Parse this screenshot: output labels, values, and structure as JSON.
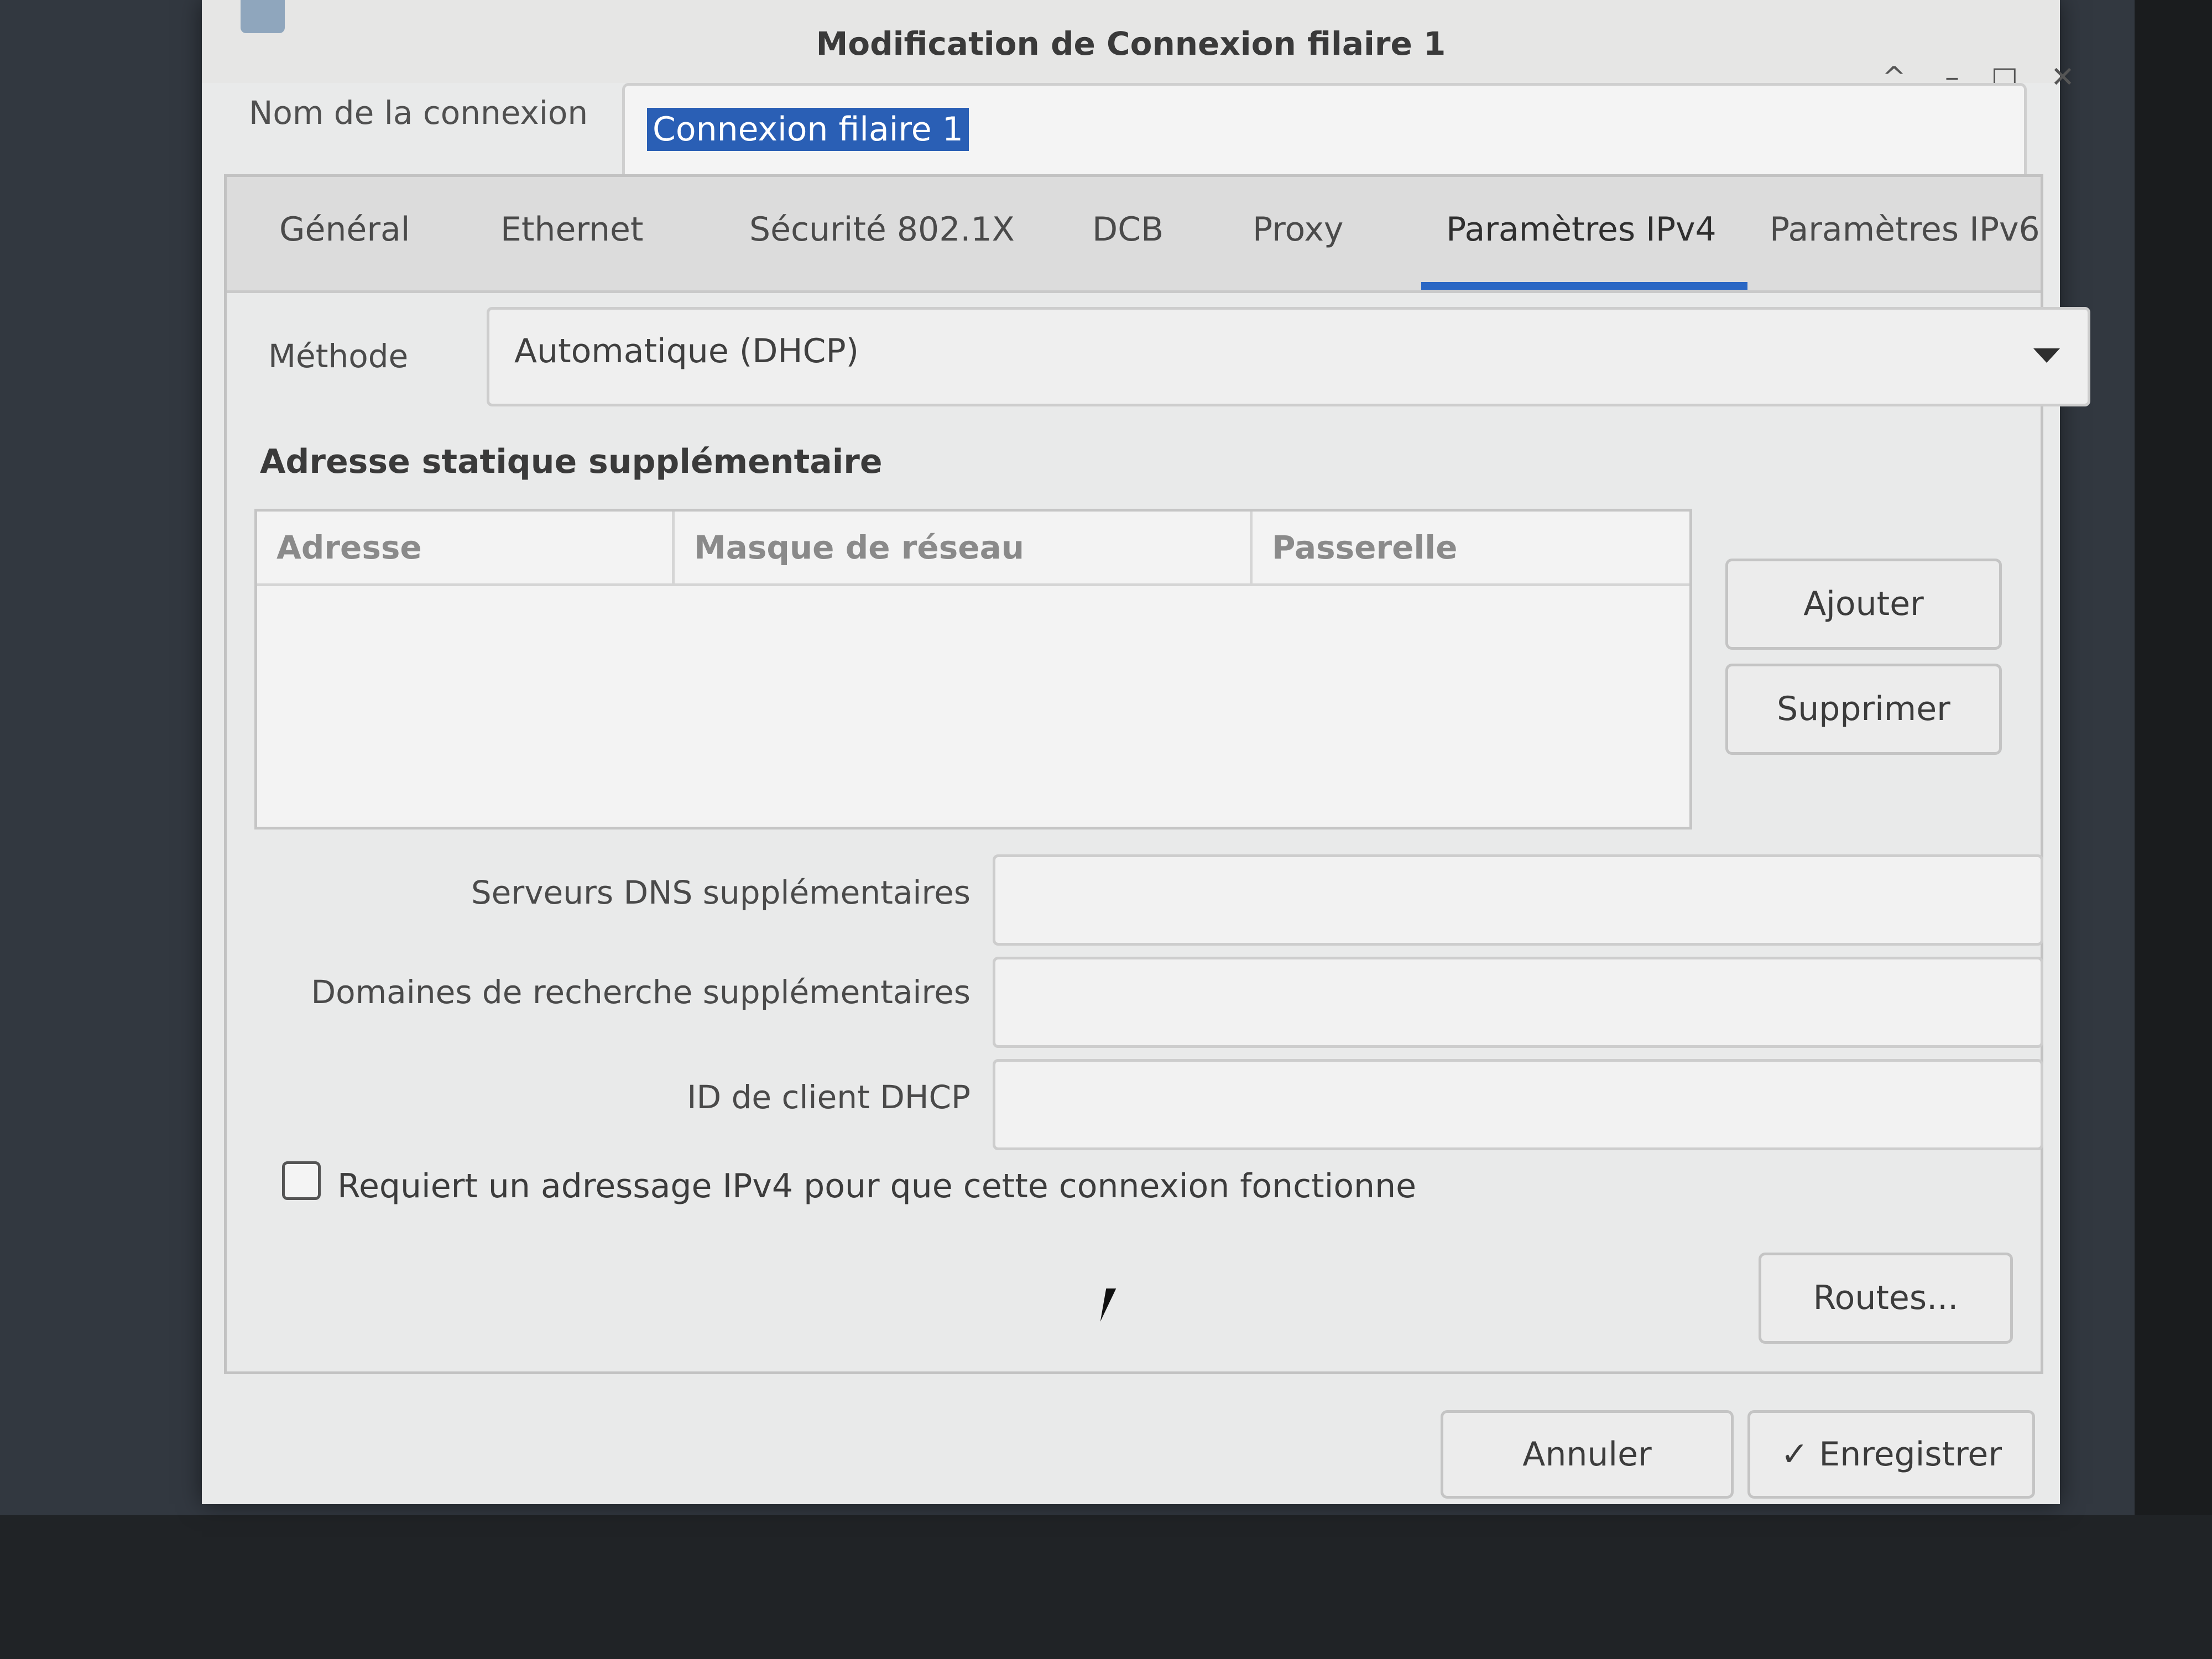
{
  "window": {
    "title": "Modification de Connexion filaire 1",
    "controls": {
      "shade": "^",
      "minimize": "–",
      "maximize": "□",
      "close": "✕"
    }
  },
  "connection": {
    "name_label": "Nom de la connexion",
    "name_value": "Connexion filaire 1"
  },
  "tabs": [
    {
      "label": "Général",
      "active": false
    },
    {
      "label": "Ethernet",
      "active": false
    },
    {
      "label": "Sécurité 802.1X",
      "active": false
    },
    {
      "label": "DCB",
      "active": false
    },
    {
      "label": "Proxy",
      "active": false
    },
    {
      "label": "Paramètres IPv4",
      "active": true
    },
    {
      "label": "Paramètres IPv6",
      "active": false
    }
  ],
  "ipv4": {
    "method_label": "Méthode",
    "method_value": "Automatique (DHCP)",
    "static_title": "Adresse statique supplémentaire",
    "table_headers": [
      "Adresse",
      "Masque de réseau",
      "Passerelle"
    ],
    "table_rows": [],
    "add_button": "Ajouter",
    "remove_button": "Supprimer",
    "dns_label": "Serveurs DNS supplémentaires",
    "dns_value": "",
    "search_label": "Domaines de recherche supplémentaires",
    "search_value": "",
    "dhcp_id_label": "ID de client DHCP",
    "dhcp_id_value": "",
    "require_label": "Requiert un adressage IPv4 pour que cette connexion fonctionne",
    "require_checked": false,
    "routes_button": "Routes..."
  },
  "footer": {
    "cancel_button": "Annuler",
    "save_button": "Enregistrer",
    "save_icon": "✓"
  },
  "colors": {
    "accent": "#2a67c4",
    "selection": "#2a5fb5"
  }
}
